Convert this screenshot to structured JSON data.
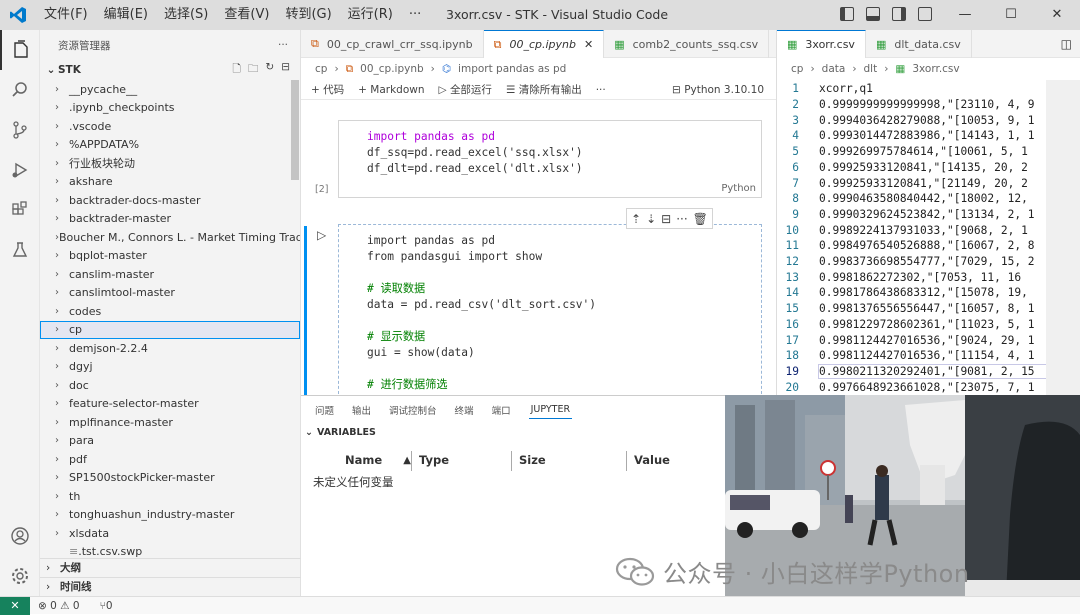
{
  "window": {
    "title": "3xorr.csv - STK - Visual Studio Code",
    "menu": [
      "文件(F)",
      "编辑(E)",
      "选择(S)",
      "查看(V)",
      "转到(G)",
      "运行(R)",
      "···"
    ],
    "controls": [
      "—",
      "☐",
      "✕"
    ]
  },
  "sidebar": {
    "header": "资源管理器",
    "more": "···",
    "root": "STK",
    "items": [
      {
        "label": "__pycache__",
        "type": "folder"
      },
      {
        "label": ".ipynb_checkpoints",
        "type": "folder"
      },
      {
        "label": ".vscode",
        "type": "folder"
      },
      {
        "label": "%APPDATA%",
        "type": "folder"
      },
      {
        "label": "行业板块轮动",
        "type": "folder"
      },
      {
        "label": "akshare",
        "type": "folder"
      },
      {
        "label": "backtrader-docs-master",
        "type": "folder"
      },
      {
        "label": "backtrader-master",
        "type": "folder"
      },
      {
        "label": "Boucher M., Connors L. - Market Timing Tradin...",
        "type": "folder"
      },
      {
        "label": "bqplot-master",
        "type": "folder"
      },
      {
        "label": "canslim-master",
        "type": "folder"
      },
      {
        "label": "canslimtool-master",
        "type": "folder"
      },
      {
        "label": "codes",
        "type": "folder"
      },
      {
        "label": "cp",
        "type": "folder",
        "selected": true
      },
      {
        "label": "demjson-2.2.4",
        "type": "folder"
      },
      {
        "label": "dgyj",
        "type": "folder"
      },
      {
        "label": "doc",
        "type": "folder"
      },
      {
        "label": "feature-selector-master",
        "type": "folder"
      },
      {
        "label": "mplfinance-master",
        "type": "folder"
      },
      {
        "label": "para",
        "type": "folder"
      },
      {
        "label": "pdf",
        "type": "folder"
      },
      {
        "label": "SP1500stockPicker-master",
        "type": "folder"
      },
      {
        "label": "th",
        "type": "folder"
      },
      {
        "label": "tonghuashun_industry-master",
        "type": "folder"
      },
      {
        "label": "xlsdata",
        "type": "folder"
      },
      {
        "label": ".tst.csv.swp",
        "type": "file"
      }
    ],
    "outline": "大纲",
    "timeline": "时间线"
  },
  "editor_left": {
    "tabs": [
      {
        "label": "00_cp_crawl_crr_ssq.ipynb",
        "active": false
      },
      {
        "label": "00_cp.ipynb",
        "active": true
      },
      {
        "label": "comb2_counts_ssq.csv",
        "active": false
      }
    ],
    "more": "···",
    "breadcrumb": [
      "cp",
      "00_cp.ipynb",
      "import pandas as pd"
    ],
    "toolbar": {
      "code": "代码",
      "markdown": "Markdown",
      "run_all": "全部运行",
      "clear": "清除所有输出",
      "more": "···",
      "kernel": "Python 3.10.10"
    },
    "cell1": {
      "lines": [
        "import pandas as pd",
        "df_ssq=pd.read_excel('ssq.xlsx')",
        "df_dlt=pd.read_excel('dlt.xlsx')"
      ],
      "lang": "Python",
      "count": "[2]"
    },
    "cell2": {
      "lines": [
        "import pandas as pd",
        "from pandasgui import show",
        "",
        "# 读取数据",
        "data = pd.read_csv('dlt_sort.csv')",
        "",
        "# 显示数据",
        "gui = show(data)",
        "",
        "# 进行数据筛选"
      ]
    }
  },
  "editor_right": {
    "tabs": [
      {
        "label": "3xorr.csv",
        "active": true
      },
      {
        "label": "dlt_data.csv",
        "active": false
      }
    ],
    "breadcrumb": [
      "cp",
      "data",
      "dlt",
      "3xorr.csv"
    ],
    "current_line": 19,
    "rows": [
      {
        "n": "1",
        "text": "xcorr,q1"
      },
      {
        "n": "2",
        "text": "0.9999999999999998,\"[23110, 4, 9"
      },
      {
        "n": "3",
        "text": "0.9994036428279088,\"[10053, 9, 1"
      },
      {
        "n": "4",
        "text": "0.9993014472883986,\"[14143, 1, 1"
      },
      {
        "n": "5",
        "text": "0.999269975784614,\"[10061, 5, 1"
      },
      {
        "n": "6",
        "text": "0.99925933120841,\"[14135, 20, 2"
      },
      {
        "n": "7",
        "text": "0.99925933120841,\"[21149, 20, 2"
      },
      {
        "n": "8",
        "text": "0.9990463580840442,\"[18002, 12,"
      },
      {
        "n": "9",
        "text": "0.9990329624523842,\"[13134, 2, 1"
      },
      {
        "n": "10",
        "text": "0.9989224137931033,\"[9068, 2, 1"
      },
      {
        "n": "11",
        "text": "0.9984976540526888,\"[16067, 2, 8"
      },
      {
        "n": "12",
        "text": "0.9983736698554777,\"[7029, 15, 2"
      },
      {
        "n": "13",
        "text": "0.9981862272302,\"[7053, 11, 16"
      },
      {
        "n": "14",
        "text": "0.9981786438683312,\"[15078, 19,"
      },
      {
        "n": "15",
        "text": "0.9981376556556447,\"[16057, 8, 1"
      },
      {
        "n": "16",
        "text": "0.9981229728602361,\"[11023, 5, 1"
      },
      {
        "n": "17",
        "text": "0.9981124427016536,\"[9024, 29, 1"
      },
      {
        "n": "18",
        "text": "0.9981124427016536,\"[11154, 4, 1"
      },
      {
        "n": "19",
        "text": "0.9980211320292401,\"[9081, 2, 15"
      },
      {
        "n": "20",
        "text": "0.9976648923661028,\"[23075, 7, 1"
      }
    ]
  },
  "panel": {
    "tabs": [
      "问题",
      "输出",
      "调试控制台",
      "终端",
      "端口",
      "JUPYTER"
    ],
    "active_tab": "JUPYTER",
    "variables_title": "VARIABLES",
    "columns": [
      "Name",
      "Type",
      "Size",
      "Value"
    ],
    "empty_text": "未定义任何变量"
  },
  "status": {
    "remote": "✕",
    "errors": "0",
    "warnings": "0",
    "ports": "0"
  },
  "watermark": "公众号 · 小白这样学Python"
}
